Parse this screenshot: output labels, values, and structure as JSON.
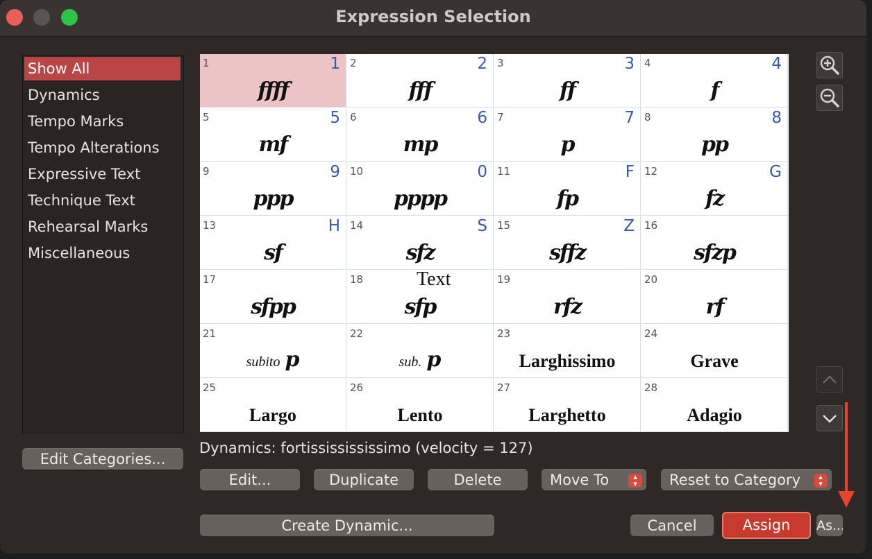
{
  "window": {
    "title": "Expression Selection"
  },
  "sidebar": {
    "items": [
      {
        "label": "Show All",
        "selected": true
      },
      {
        "label": "Dynamics"
      },
      {
        "label": "Tempo Marks"
      },
      {
        "label": "Tempo Alterations"
      },
      {
        "label": "Expressive Text"
      },
      {
        "label": "Technique Text"
      },
      {
        "label": "Rehearsal Marks"
      },
      {
        "label": "Miscellaneous"
      }
    ],
    "edit_categories_label": "Edit Categories..."
  },
  "grid": {
    "cells": [
      {
        "num": "1",
        "key": "1",
        "mark": "ffff"
      },
      {
        "num": "2",
        "key": "2",
        "mark": "fff"
      },
      {
        "num": "3",
        "key": "3",
        "mark": "ff"
      },
      {
        "num": "4",
        "key": "4",
        "mark": "f"
      },
      {
        "num": "5",
        "key": "5",
        "mark": "mf"
      },
      {
        "num": "6",
        "key": "6",
        "mark": "mp"
      },
      {
        "num": "7",
        "key": "7",
        "mark": "p"
      },
      {
        "num": "8",
        "key": "8",
        "mark": "pp"
      },
      {
        "num": "9",
        "key": "9",
        "mark": "ppp"
      },
      {
        "num": "10",
        "key": "0",
        "mark": "pppp"
      },
      {
        "num": "11",
        "key": "F",
        "mark": "fp"
      },
      {
        "num": "12",
        "key": "G",
        "mark": "fz"
      },
      {
        "num": "13",
        "key": "H",
        "mark": "sf"
      },
      {
        "num": "14",
        "key": "S",
        "mark": "sfz"
      },
      {
        "num": "15",
        "key": "Z",
        "mark": "sffz"
      },
      {
        "num": "16",
        "key": "",
        "mark": "sfzp"
      },
      {
        "num": "17",
        "key": "",
        "mark": "sfpp"
      },
      {
        "num": "18",
        "key": "",
        "mark": "sfp",
        "text": "Text"
      },
      {
        "num": "19",
        "key": "",
        "mark": "rfz"
      },
      {
        "num": "20",
        "key": "",
        "mark": "rf"
      },
      {
        "num": "21",
        "key": "",
        "mark": "subito p",
        "prefix": "subito",
        "dyn": "p"
      },
      {
        "num": "22",
        "key": "",
        "mark": "sub. p",
        "prefix": "sub.",
        "dyn": "p"
      },
      {
        "num": "23",
        "key": "",
        "mark": "Larghissimo",
        "word": true
      },
      {
        "num": "24",
        "key": "",
        "mark": "Grave",
        "word": true
      },
      {
        "num": "25",
        "key": "",
        "mark": "Largo",
        "word": true
      },
      {
        "num": "26",
        "key": "",
        "mark": "Lento",
        "word": true
      },
      {
        "num": "27",
        "key": "",
        "mark": "Larghetto",
        "word": true
      },
      {
        "num": "28",
        "key": "",
        "mark": "Adagio",
        "word": true
      }
    ]
  },
  "status": {
    "text": "Dynamics: fortississississimo (velocity = 127)"
  },
  "actions": {
    "edit_label": "Edit...",
    "duplicate_label": "Duplicate",
    "delete_label": "Delete",
    "move_to_label": "Move To",
    "reset_label": "Reset to Category",
    "create_label": "Create Dynamic...",
    "cancel_label": "Cancel",
    "assign_label": "Assign",
    "as_label": "As..."
  },
  "icons": {
    "zoom_in": "zoom-in-icon",
    "zoom_out": "zoom-out-icon",
    "scroll_up": "chevron-up-icon",
    "scroll_down": "chevron-down-icon"
  },
  "colors": {
    "selection": "#b94545",
    "selected_cell": "#ecc4c6",
    "shortcut_key": "#3a5aa8",
    "assign": "#c93a2e",
    "annotation_arrow": "#e8442a"
  }
}
